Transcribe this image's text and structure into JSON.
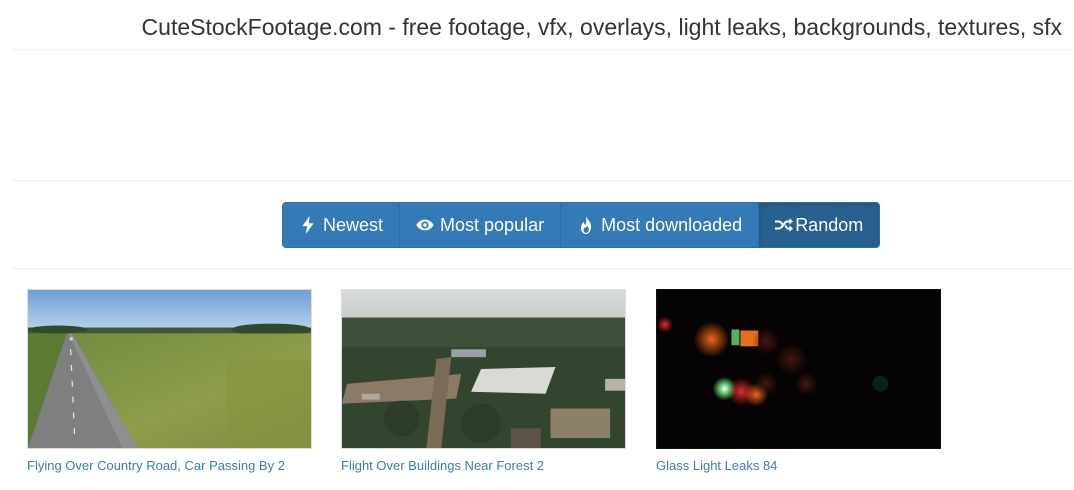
{
  "header": {
    "title": "CuteStockFootage.com - free footage, vfx, overlays, light leaks, backgrounds, textures, sfx"
  },
  "sort_bar": {
    "buttons": [
      {
        "label": "Newest",
        "icon": "bolt-icon",
        "active": false
      },
      {
        "label": "Most popular",
        "icon": "eye-icon",
        "active": false
      },
      {
        "label": "Most downloaded",
        "icon": "fire-icon",
        "active": false
      },
      {
        "label": "Random",
        "icon": "shuffle-icon",
        "active": true
      }
    ]
  },
  "videos": [
    {
      "title": "Flying Over Country Road, Car Passing By 2"
    },
    {
      "title": "Flight Over Buildings Near Forest 2"
    },
    {
      "title": "Glass Light Leaks 84"
    }
  ],
  "colors": {
    "button_bg": "#337ab7",
    "button_active_bg": "#286090",
    "link": "#3f7ab6"
  }
}
